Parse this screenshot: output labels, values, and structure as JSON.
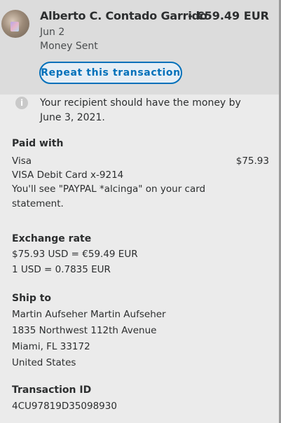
{
  "header": {
    "recipient_name": "Alberto C. Contado Garrido",
    "amount": "- €59.49 EUR",
    "date": "Jun 2",
    "type": "Money Sent",
    "repeat_label": "Repeat this transaction"
  },
  "notice": "Your recipient should have the money by June 3, 2021.",
  "paid_with": {
    "title": "Paid with",
    "method": "Visa",
    "amount": "$75.93",
    "card": "VISA Debit Card x-9214",
    "statement_line1": "You'll see \"PAYPAL *alcinga\" on your card",
    "statement_line2": "statement."
  },
  "exchange_rate": {
    "title": "Exchange rate",
    "line1": "$75.93 USD = €59.49 EUR",
    "line2": "1 USD = 0.7835 EUR"
  },
  "ship_to": {
    "title": "Ship to",
    "line1": "Martin Aufseher Martin Aufseher",
    "line2": "1835 Northwest 112th Avenue",
    "line3": "Miami, FL 33172",
    "line4": "United States"
  },
  "transaction": {
    "title": "Transaction ID",
    "id": "4CU97819D35098930"
  },
  "colors": {
    "accent": "#0070ba",
    "background": "#ebebeb",
    "header_background": "#dcdcdc"
  },
  "icons": {
    "info": "info-icon",
    "avatar": "avatar"
  }
}
